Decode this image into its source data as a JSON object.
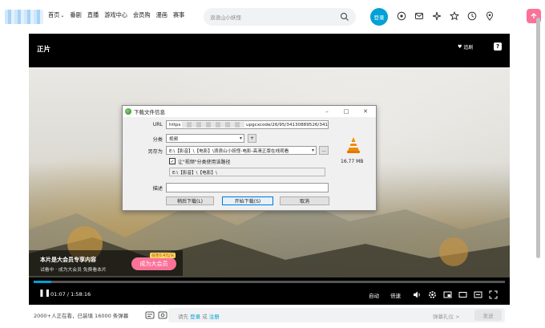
{
  "nav": {
    "links": [
      "首页",
      "番剧",
      "直播",
      "游戏中心",
      "会员购",
      "漫画",
      "赛事"
    ],
    "search_placeholder": "浪浪山小妖怪",
    "login_label": "登录"
  },
  "player": {
    "title": "正片",
    "follow_label": "追剧",
    "vip": {
      "headline": "本片是大会员专享内容",
      "subtext": "试看中 · 成为大会员 免费看本片",
      "button_label": "成为大会员",
      "tag": "低至0.4元/天"
    },
    "progress_fraction": 0.037,
    "current_time": "01:07",
    "duration": "1:58:16",
    "auto_label": "自动",
    "speed_label": "倍速",
    "accent_color": "#00a1d6"
  },
  "dialog": {
    "title": "下载文件信息",
    "url_label": "URL",
    "url_prefix": "https",
    "url_suffix": "upgcxcode/26/95/34130889526/341",
    "category_label": "分类",
    "category_value": "视频",
    "save_as_label": "另存为",
    "save_as_value": "E:\\【影音】\\【电影】\\浪浪山小妖怪-电影-高清正版在线观看",
    "checkbox_label": "让\"视频\"分类使用该路径",
    "path_value": "E:\\【影音】\\【电影】\\",
    "description_label": "描述",
    "file_size": "16.77 MB",
    "buttons": {
      "later": "稍后下载(L)",
      "start": "开始下载(S)",
      "cancel": "取消"
    }
  },
  "bottom": {
    "viewers": "2000+人正在看，已装填 16000 条弹幕",
    "hint_prefix": "请先",
    "login_link": "登录",
    "or_text": "或",
    "register_link": "注册",
    "etiquette": "弹幕礼仪 >",
    "send_label": "发送"
  }
}
